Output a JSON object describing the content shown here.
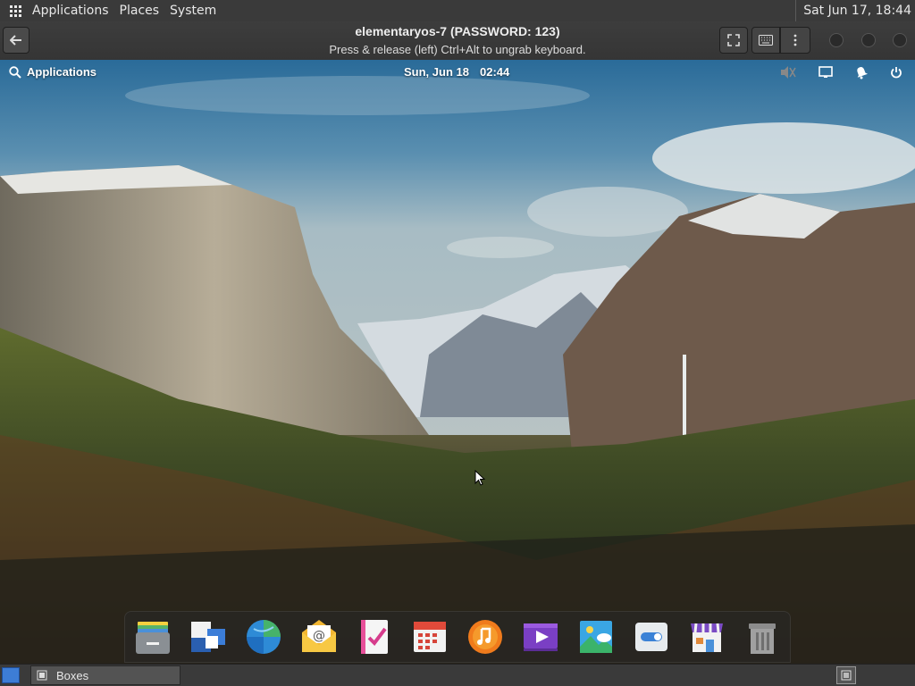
{
  "host_panel": {
    "menu": [
      "Applications",
      "Places",
      "System"
    ],
    "clock": "Sat Jun 17, 18:44"
  },
  "boxes_header": {
    "title": "elementaryos-7 (PASSWORD: 123)",
    "subtitle": "Press & release (left) Ctrl+Alt to ungrab keyboard."
  },
  "guest_panel": {
    "apps_label": "Applications",
    "date": "Sun, Jun 18",
    "time": "02:44"
  },
  "dock": {
    "items": [
      "files-icon",
      "multitasking-view-icon",
      "web-browser-icon",
      "mail-icon",
      "tasks-icon",
      "calendar-icon",
      "music-icon",
      "videos-icon",
      "photos-icon",
      "system-settings-icon",
      "appcenter-icon",
      "trash-icon"
    ]
  },
  "taskbar": {
    "task_label": "Boxes"
  },
  "colors": {
    "host_panel": "#3a3a3a",
    "accent_blue": "#3d7dd6"
  }
}
